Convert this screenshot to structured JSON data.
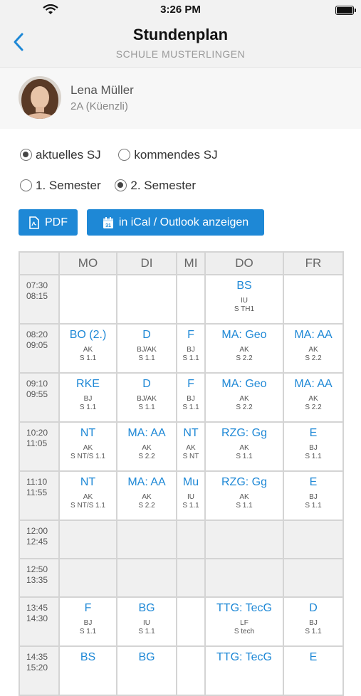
{
  "status": {
    "time": "3:26 PM"
  },
  "nav": {
    "title": "Stundenplan",
    "subtitle": "SCHULE MUSTERLINGEN"
  },
  "profile": {
    "name": "Lena Müller",
    "class": "2A (Küenzli)"
  },
  "filters": {
    "year_current": "aktuelles SJ",
    "year_next": "kommendes SJ",
    "sem1": "1. Semester",
    "sem2": "2. Semester"
  },
  "buttons": {
    "pdf": "PDF",
    "ical": "in iCal / Outlook anzeigen"
  },
  "days": [
    "MO",
    "DI",
    "MI",
    "DO",
    "FR"
  ],
  "accent": "#1e88d6",
  "rows": [
    {
      "start": "07:30",
      "end": "08:15",
      "cells": [
        null,
        null,
        null,
        {
          "s": "BS",
          "t": "IU",
          "r": "S TH1"
        },
        null
      ]
    },
    {
      "start": "08:20",
      "end": "09:05",
      "cells": [
        {
          "s": "BO (2.)",
          "t": "AK",
          "r": "S 1.1"
        },
        {
          "s": "D",
          "t": "BJ/AK",
          "r": "S 1.1"
        },
        {
          "s": "F",
          "t": "BJ",
          "r": "S 1.1"
        },
        {
          "s": "MA: Geo",
          "t": "AK",
          "r": "S 2.2"
        },
        {
          "s": "MA: AA",
          "t": "AK",
          "r": "S 2.2"
        }
      ]
    },
    {
      "start": "09:10",
      "end": "09:55",
      "cells": [
        {
          "s": "RKE",
          "t": "BJ",
          "r": "S 1.1"
        },
        {
          "s": "D",
          "t": "BJ/AK",
          "r": "S 1.1"
        },
        {
          "s": "F",
          "t": "BJ",
          "r": "S 1.1"
        },
        {
          "s": "MA: Geo",
          "t": "AK",
          "r": "S 2.2"
        },
        {
          "s": "MA: AA",
          "t": "AK",
          "r": "S 2.2"
        }
      ]
    },
    {
      "start": "10:20",
      "end": "11:05",
      "cells": [
        {
          "s": "NT",
          "t": "AK",
          "r": "S NT/S 1.1"
        },
        {
          "s": "MA: AA",
          "t": "AK",
          "r": "S 2.2"
        },
        {
          "s": "NT",
          "t": "AK",
          "r": "S NT"
        },
        {
          "s": "RZG: Gg",
          "t": "AK",
          "r": "S 1.1"
        },
        {
          "s": "E",
          "t": "BJ",
          "r": "S 1.1"
        }
      ]
    },
    {
      "start": "11:10",
      "end": "11:55",
      "cells": [
        {
          "s": "NT",
          "t": "AK",
          "r": "S NT/S 1.1"
        },
        {
          "s": "MA: AA",
          "t": "AK",
          "r": "S 2.2"
        },
        {
          "s": "Mu",
          "t": "IU",
          "r": "S 1.1"
        },
        {
          "s": "RZG: Gg",
          "t": "AK",
          "r": "S 1.1"
        },
        {
          "s": "E",
          "t": "BJ",
          "r": "S 1.1"
        }
      ]
    },
    {
      "start": "12:00",
      "end": "12:45",
      "pause": true,
      "cells": [
        null,
        null,
        null,
        null,
        null
      ]
    },
    {
      "start": "12:50",
      "end": "13:35",
      "pause": true,
      "cells": [
        null,
        null,
        null,
        null,
        null
      ]
    },
    {
      "start": "13:45",
      "end": "14:30",
      "cells": [
        {
          "s": "F",
          "t": "BJ",
          "r": "S 1.1"
        },
        {
          "s": "BG",
          "t": "IU",
          "r": "S 1.1"
        },
        null,
        {
          "s": "TTG: TecG",
          "t": "LF",
          "r": "S tech"
        },
        {
          "s": "D",
          "t": "BJ",
          "r": "S 1.1"
        }
      ]
    },
    {
      "start": "14:35",
      "end": "15:20",
      "cells": [
        {
          "s": "BS",
          "t": "",
          "r": ""
        },
        {
          "s": "BG",
          "t": "",
          "r": ""
        },
        null,
        {
          "s": "TTG: TecG",
          "t": "",
          "r": ""
        },
        {
          "s": "E",
          "t": "",
          "r": ""
        }
      ]
    }
  ]
}
